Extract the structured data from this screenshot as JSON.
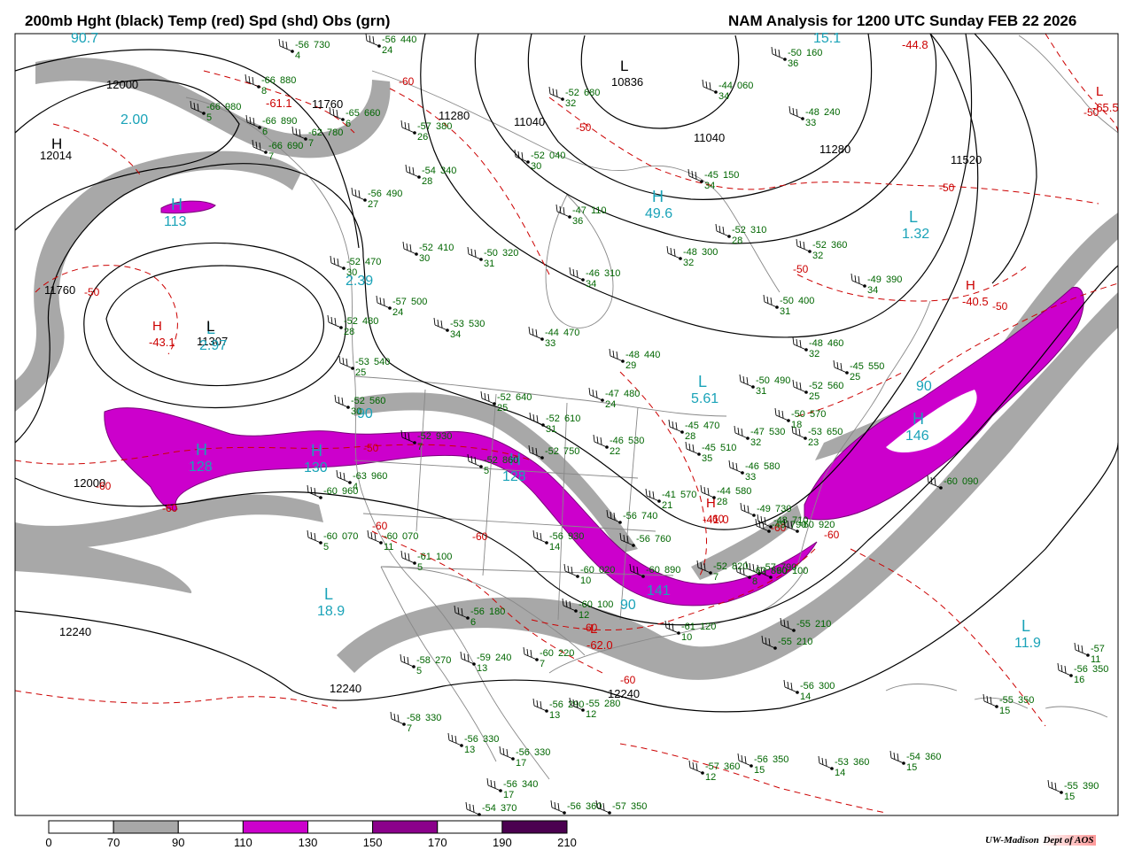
{
  "header": {
    "left_title": "200mb Hght (black) Temp (red) Spd (shd) Obs (grn)",
    "right_title": "NAM Analysis for 1200 UTC Sunday  FEB 22 2026"
  },
  "legend": {
    "tick_labels": [
      "0",
      "70",
      "90",
      "110",
      "130",
      "150",
      "170",
      "190",
      "210"
    ],
    "bin_colors": [
      "#ffffff",
      "#a8a8a8",
      "#ffffff",
      "#cc00cc",
      "#ffffff",
      "#8b008b",
      "#ffffff",
      "#4b0050"
    ]
  },
  "colors": {
    "height_contour": "#000000",
    "temperature_contour": "#cc0000",
    "obs": "#006600",
    "centers": "#1aa3b8",
    "speed_70_90": "#a8a8a8",
    "speed_110_130": "#cc00cc",
    "borders": "#888888"
  },
  "credit": {
    "org": "UW-Madison",
    "dept": "Dept of AOS"
  },
  "height_labels": [
    {
      "t": "12000"
    },
    {
      "t": "12014"
    },
    {
      "t": "11760"
    },
    {
      "t": "11280"
    },
    {
      "t": "11040"
    },
    {
      "t": "10836"
    },
    {
      "t": "11040"
    },
    {
      "t": "11280"
    },
    {
      "t": "11520"
    },
    {
      "t": "11760"
    },
    {
      "t": "11307"
    },
    {
      "t": "12000"
    },
    {
      "t": "12240"
    },
    {
      "t": "12240"
    },
    {
      "t": "12240"
    }
  ],
  "temp_labels": [
    {
      "t": "-60"
    },
    {
      "t": "-50"
    },
    {
      "t": "-50"
    },
    {
      "t": "-50"
    },
    {
      "t": "-50"
    },
    {
      "t": "-60"
    },
    {
      "t": "-60"
    },
    {
      "t": "-60"
    },
    {
      "t": "-60"
    },
    {
      "t": "-60"
    },
    {
      "t": "-60"
    },
    {
      "t": "-60"
    },
    {
      "t": "-50"
    },
    {
      "t": "-50"
    },
    {
      "t": "-60"
    },
    {
      "t": "-50"
    },
    {
      "t": "-60"
    }
  ],
  "temp_extrema": [
    {
      "l": "H",
      "v": "-43.1"
    },
    {
      "l": "H",
      "v": "-40.5"
    },
    {
      "l": "H",
      "v": "-41.0"
    },
    {
      "l": "L",
      "v": "-62.0"
    },
    {
      "l": "",
      "v": "-44.8"
    },
    {
      "l": "L",
      "v": "-65.5"
    },
    {
      "l": "",
      "v": "-61.1"
    }
  ],
  "speed_centers": [
    {
      "l": "",
      "v": "90.7"
    },
    {
      "l": "",
      "v": "2.00"
    },
    {
      "l": "H",
      "v": "113"
    },
    {
      "l": "L",
      "v": "2.97"
    },
    {
      "l": "H",
      "v": "128"
    },
    {
      "l": "H",
      "v": "130"
    },
    {
      "l": "",
      "v": "2.39"
    },
    {
      "l": "H",
      "v": "128"
    },
    {
      "l": "",
      "v": "141"
    },
    {
      "l": "",
      "v": "90"
    },
    {
      "l": "H",
      "v": "49.6"
    },
    {
      "l": "L",
      "v": "5.61"
    },
    {
      "l": "L",
      "v": "1.32"
    },
    {
      "l": "H",
      "v": "146"
    },
    {
      "l": "",
      "v": "90"
    },
    {
      "l": "L",
      "v": "18.9"
    },
    {
      "l": "L",
      "v": "11.9"
    },
    {
      "l": "",
      "v": "15.1"
    },
    {
      "l": "",
      "v": "90"
    }
  ],
  "height_centers": [
    {
      "l": "H"
    },
    {
      "l": "L"
    },
    {
      "l": "L"
    }
  ],
  "obs": [
    {
      "a": "-56",
      "b": "440",
      "c": "24"
    },
    {
      "a": "-56",
      "b": "730",
      "c": "4"
    },
    {
      "a": "-66",
      "b": "880",
      "c": "8"
    },
    {
      "a": "-66",
      "b": "980",
      "c": "5"
    },
    {
      "a": "-66",
      "b": "890",
      "c": "6"
    },
    {
      "a": "-62",
      "b": "780",
      "c": "7"
    },
    {
      "a": "-66",
      "b": "690",
      "c": "7"
    },
    {
      "a": "-65",
      "b": "660",
      "c": "6"
    },
    {
      "a": "-57",
      "b": "380",
      "c": "26"
    },
    {
      "a": "-54",
      "b": "340",
      "c": "28"
    },
    {
      "a": "-56",
      "b": "490",
      "c": "27"
    },
    {
      "a": "-52",
      "b": "470",
      "c": "30"
    },
    {
      "a": "-57",
      "b": "500",
      "c": "24"
    },
    {
      "a": "-52",
      "b": "480",
      "c": "28"
    },
    {
      "a": "-53",
      "b": "540",
      "c": "25"
    },
    {
      "a": "-52",
      "b": "560",
      "c": "30"
    },
    {
      "a": "-52",
      "b": "410",
      "c": "30"
    },
    {
      "a": "-50",
      "b": "320",
      "c": "31"
    },
    {
      "a": "-52",
      "b": "680",
      "c": "32"
    },
    {
      "a": "-52",
      "b": "040",
      "c": "30"
    },
    {
      "a": "-47",
      "b": "110",
      "c": "36"
    },
    {
      "a": "-46",
      "b": "310",
      "c": "34"
    },
    {
      "a": "-53",
      "b": "530",
      "c": "34"
    },
    {
      "a": "-44",
      "b": "470",
      "c": "33"
    },
    {
      "a": "-44",
      "b": "060",
      "c": "34"
    },
    {
      "a": "-50",
      "b": "160",
      "c": "36"
    },
    {
      "a": "-48",
      "b": "240",
      "c": "33"
    },
    {
      "a": "-45",
      "b": "150",
      "c": "34"
    },
    {
      "a": "-52",
      "b": "310",
      "c": "28"
    },
    {
      "a": "-48",
      "b": "300",
      "c": "32"
    },
    {
      "a": "-52",
      "b": "360",
      "c": "32"
    },
    {
      "a": "-49",
      "b": "390",
      "c": "34"
    },
    {
      "a": "-50",
      "b": "400",
      "c": "31"
    },
    {
      "a": "-48",
      "b": "460",
      "c": "32"
    },
    {
      "a": "-45",
      "b": "550",
      "c": "25"
    },
    {
      "a": "-52",
      "b": "560",
      "c": "25"
    },
    {
      "a": "-48",
      "b": "440",
      "c": "29"
    },
    {
      "a": "-47",
      "b": "480",
      "c": "24"
    },
    {
      "a": "-50",
      "b": "490",
      "c": "31"
    },
    {
      "a": "-50",
      "b": "570",
      "c": "18"
    },
    {
      "a": "-45",
      "b": "470",
      "c": "28"
    },
    {
      "a": "-47",
      "b": "530",
      "c": "32"
    },
    {
      "a": "-53",
      "b": "650",
      "c": "23"
    },
    {
      "a": "-46",
      "b": "530",
      "c": "22"
    },
    {
      "a": "-45",
      "b": "510",
      "c": "35"
    },
    {
      "a": "-46",
      "b": "580",
      "c": "33"
    },
    {
      "a": "-44",
      "b": "580",
      "c": "28"
    },
    {
      "a": "-41",
      "b": "570",
      "c": "21"
    },
    {
      "a": "-52",
      "b": "640",
      "c": "25"
    },
    {
      "a": "-52",
      "b": "610",
      "c": "31"
    },
    {
      "a": "-52",
      "b": "750",
      "c": ""
    },
    {
      "a": "-52",
      "b": "860",
      "c": "5"
    },
    {
      "a": "-52",
      "b": "930",
      "c": "7"
    },
    {
      "a": "-63",
      "b": "960",
      "c": "4"
    },
    {
      "a": "-60",
      "b": "960",
      "c": ""
    },
    {
      "a": "-60",
      "b": "070",
      "c": "5"
    },
    {
      "a": "-60",
      "b": "070",
      "c": "11"
    },
    {
      "a": "-61",
      "b": "100",
      "c": "5"
    },
    {
      "a": "-56",
      "b": "180",
      "c": "6"
    },
    {
      "a": "-56",
      "b": "930",
      "c": "14"
    },
    {
      "a": "-56",
      "b": "740",
      "c": ""
    },
    {
      "a": "-56",
      "b": "760",
      "c": ""
    },
    {
      "a": "-60",
      "b": "020",
      "c": "10"
    },
    {
      "a": "-60",
      "b": "890",
      "c": ""
    },
    {
      "a": "-60",
      "b": "100",
      "c": "12"
    },
    {
      "a": "-49",
      "b": "730",
      "c": ""
    },
    {
      "a": "-48",
      "b": "710",
      "c": ""
    },
    {
      "a": "-49",
      "b": "790",
      "c": ""
    },
    {
      "a": "-60",
      "b": "920",
      "c": ""
    },
    {
      "a": "-57",
      "b": "790",
      "c": ""
    },
    {
      "a": "-60",
      "b": "100",
      "c": ""
    },
    {
      "a": "-61",
      "b": "120",
      "c": "10"
    },
    {
      "a": "-55",
      "b": "210",
      "c": ""
    },
    {
      "a": "-55",
      "b": "210",
      "c": ""
    },
    {
      "a": "-60",
      "b": "090",
      "c": ""
    },
    {
      "a": "-58",
      "b": "270",
      "c": "5"
    },
    {
      "a": "-59",
      "b": "240",
      "c": "13"
    },
    {
      "a": "-60",
      "b": "220",
      "c": "7"
    },
    {
      "a": "-56",
      "b": "300",
      "c": "14"
    },
    {
      "a": "-58",
      "b": "330",
      "c": "7"
    },
    {
      "a": "-56",
      "b": "290",
      "c": "13"
    },
    {
      "a": "-55",
      "b": "280",
      "c": "12"
    },
    {
      "a": "-56",
      "b": "330",
      "c": "13"
    },
    {
      "a": "-56",
      "b": "330",
      "c": "17"
    },
    {
      "a": "-56",
      "b": "340",
      "c": "17"
    },
    {
      "a": "-54",
      "b": "370",
      "c": ""
    },
    {
      "a": "-56",
      "b": "360",
      "c": ""
    },
    {
      "a": "-57",
      "b": "350",
      "c": ""
    },
    {
      "a": "-57",
      "b": "360",
      "c": "12"
    },
    {
      "a": "-56",
      "b": "350",
      "c": "15"
    },
    {
      "a": "-53",
      "b": "360",
      "c": "14"
    },
    {
      "a": "-54",
      "b": "360",
      "c": "15"
    },
    {
      "a": "-55",
      "b": "390",
      "c": "15"
    },
    {
      "a": "-55",
      "b": "350",
      "c": "15"
    },
    {
      "a": "-56",
      "b": "350",
      "c": "16"
    },
    {
      "a": "-57",
      "b": "",
      "c": "11"
    },
    {
      "a": "-52",
      "b": "820",
      "c": "7"
    },
    {
      "a": "-63",
      "b": "890",
      "c": "8"
    }
  ]
}
